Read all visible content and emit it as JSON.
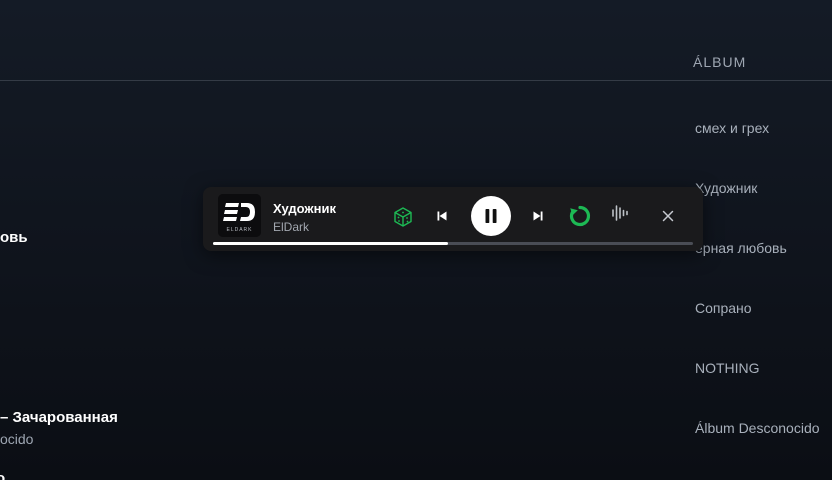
{
  "table": {
    "album_header": "ÁLBUM",
    "albums": [
      "смех и грех",
      "Художник",
      "ёрная любовь",
      "Сопрано",
      "NOTHING",
      "Álbum Desconocido"
    ],
    "left_fragments": {
      "track_a": "овь",
      "track_b": "– Зачарованная",
      "artist_b": "ocido",
      "track_c": "о"
    }
  },
  "player": {
    "title": "Художник",
    "artist": "ElDark",
    "cover_text": "ELDARK",
    "progress": 0.49,
    "accent_color": "#1db954",
    "icons": {
      "cube": "cube-icon",
      "prev": "skip-previous-icon",
      "play_pause": "pause-icon",
      "next": "skip-next-icon",
      "loop": "repeat-icon",
      "visualizer": "waveform-icon",
      "close": "close-icon"
    }
  }
}
